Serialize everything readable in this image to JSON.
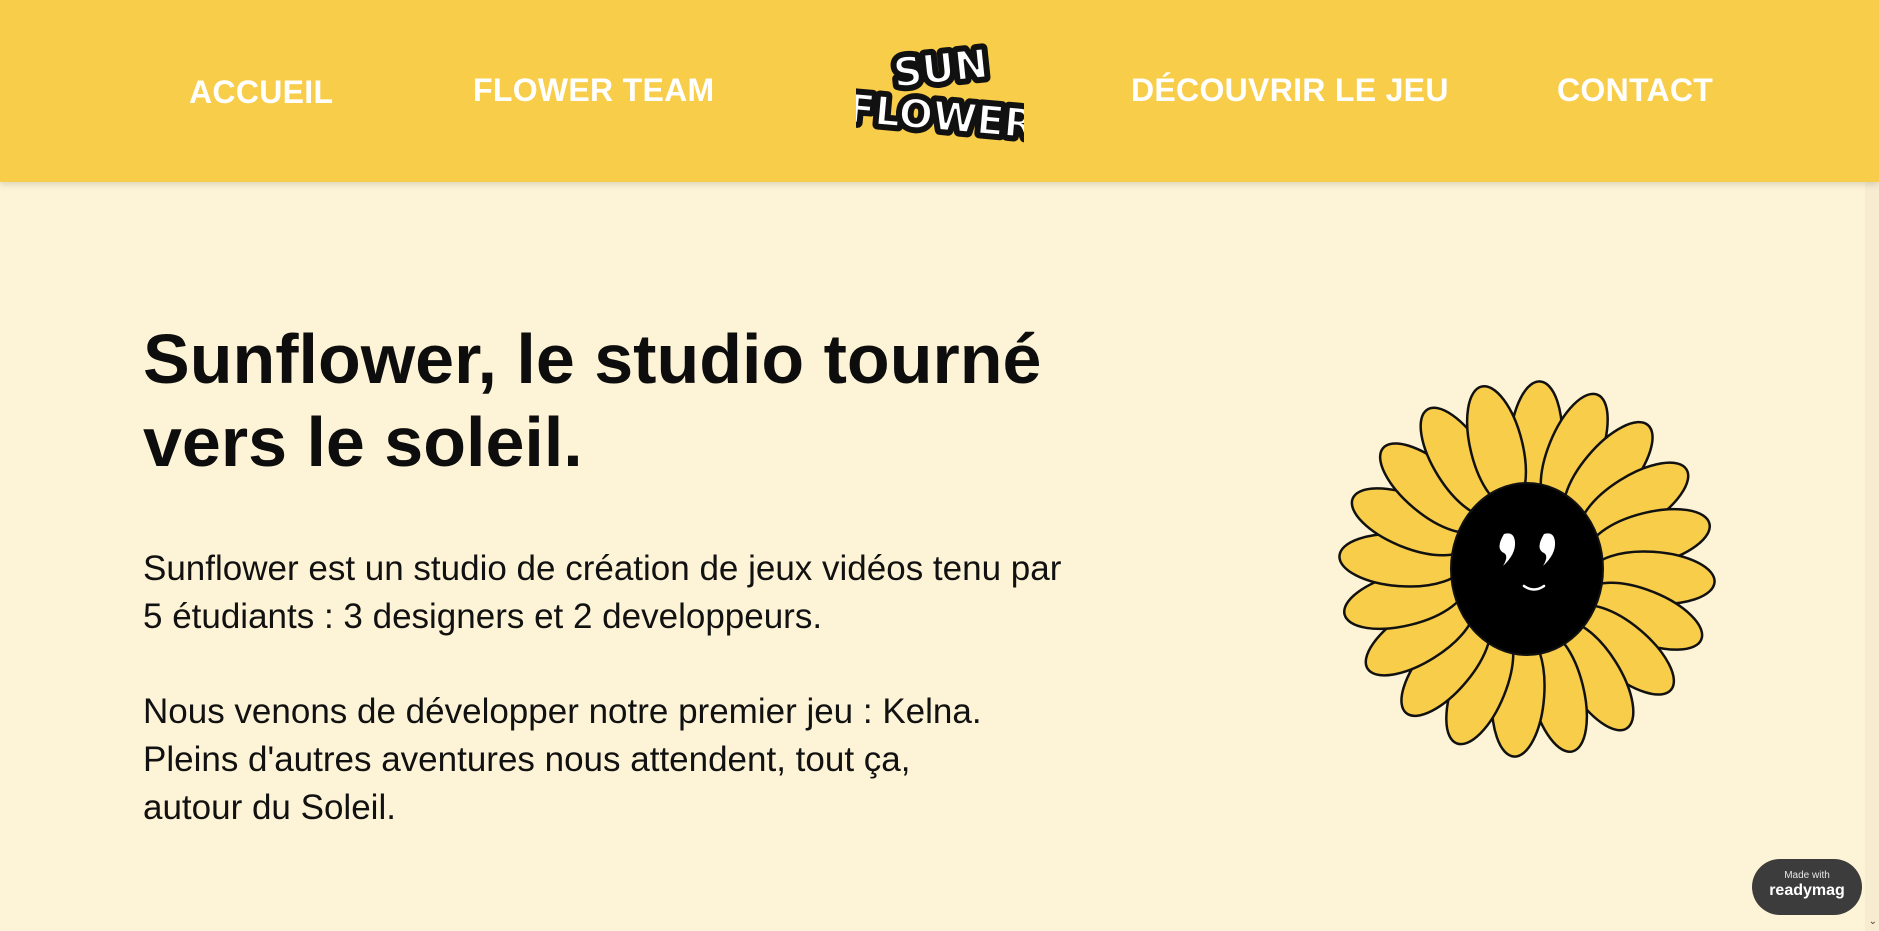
{
  "nav": {
    "items": [
      {
        "label": "ACCUEIL"
      },
      {
        "label": "FLOWER TEAM"
      },
      {
        "label": "DÉCOUVRIR LE JEU"
      },
      {
        "label": "CONTACT"
      }
    ],
    "logo_text": "SUN FLOWER"
  },
  "hero": {
    "heading": "Sunflower, le studio tourné vers le soleil.",
    "paragraph1": [
      "Sunflower est un studio de création de jeux vidéos tenu par",
      "5 étudiants : 3 designers et 2 developpeurs."
    ],
    "paragraph2": [
      "Nous venons de développer notre premier jeu : Kelna.",
      "Pleins d'autres aventures nous attendent, tout ça,",
      "autour du Soleil."
    ]
  },
  "badge": {
    "small": "Made with",
    "brand": "readymag"
  },
  "colors": {
    "header": "#f8cd4a",
    "background": "#fdf3d6",
    "petal": "#f8cd4a",
    "text": "#0d0d0d"
  },
  "icons": {
    "logo": "sunflower-logo",
    "illustration": "smiling-sunflower-illustration"
  }
}
